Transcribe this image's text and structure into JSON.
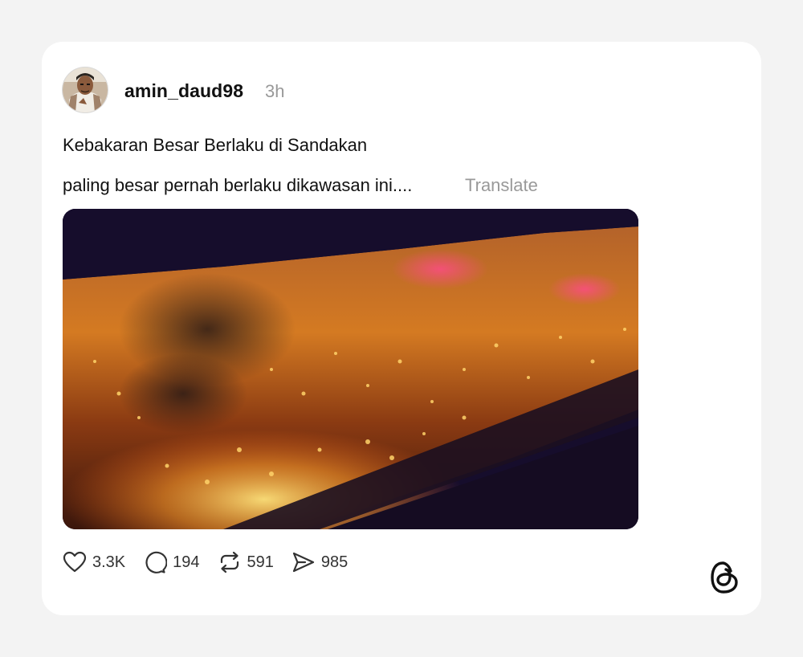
{
  "post": {
    "username": "amin_daud98",
    "timestamp": "3h",
    "text_line1": "Kebakaran Besar Berlaku di Sandakan",
    "text_line2": "paling besar pernah berlaku dikawasan ini....",
    "translate_label": "Translate",
    "media_icon": "fire-video-thumbnail"
  },
  "actions": {
    "likes": "3.3K",
    "replies": "194",
    "reposts": "591",
    "shares": "985"
  },
  "icons": {
    "like": "heart-icon",
    "reply": "comment-bubble-icon",
    "repost": "repost-arrows-icon",
    "share": "send-icon",
    "brand": "threads-logo-icon"
  },
  "colors": {
    "background": "#f3f3f3",
    "card": "#ffffff",
    "text": "#111111",
    "muted": "#999999"
  }
}
